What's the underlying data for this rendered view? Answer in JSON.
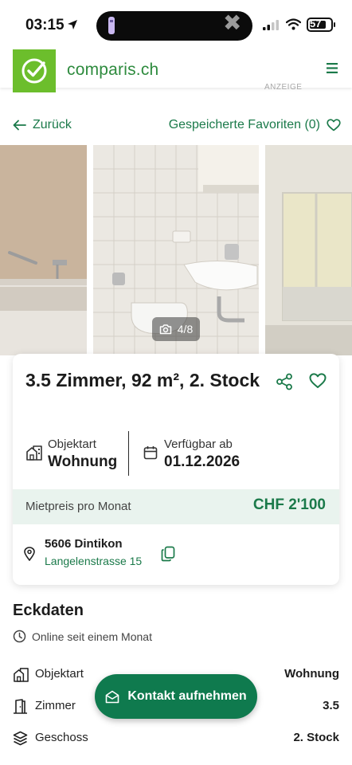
{
  "status_bar": {
    "time": "03:15",
    "battery": "57",
    "icons": [
      "location-arrow-icon",
      "signal-icon",
      "wifi-icon",
      "battery-icon"
    ]
  },
  "header": {
    "brand": "comparis.ch",
    "logo_icon": "check-circle-icon",
    "menu_icon": "menu-icon",
    "ad_label": "ANZEIGE",
    "colors": {
      "logo_green": "#6cbe2c",
      "brand_green": "#2e8b3e"
    }
  },
  "nav": {
    "back_label": "Zurück",
    "favorites_label": "Gespeicherte Favoriten (0)"
  },
  "gallery": {
    "counter": "4/8",
    "camera_icon": "camera-icon"
  },
  "listing": {
    "title": "3.5 Zimmer, 92 m², 2. Stock",
    "type_label": "Objektart",
    "type_value": "Wohnung",
    "available_label": "Verfügbar ab",
    "available_value": "01.12.2026",
    "price_label": "Mietpreis pro Monat",
    "price_value": "CHF 2'100",
    "address_city": "5606 Dintikon",
    "address_street": "Langelenstrasse 15",
    "accent_color": "#1b7a4a"
  },
  "eckdaten": {
    "title": "Eckdaten",
    "online_since": "Online seit einem Monat",
    "rows": [
      {
        "label": "Objektart",
        "value": "Wohnung",
        "icon": "building-icon"
      },
      {
        "label": "Zimmer",
        "value": "3.5",
        "icon": "door-icon"
      },
      {
        "label": "Geschoss",
        "value": "2. Stock",
        "icon": "layers-icon"
      }
    ]
  },
  "contact_button": {
    "label": "Kontakt aufnehmen",
    "icon": "mail-icon",
    "color": "#0f7a4e"
  }
}
